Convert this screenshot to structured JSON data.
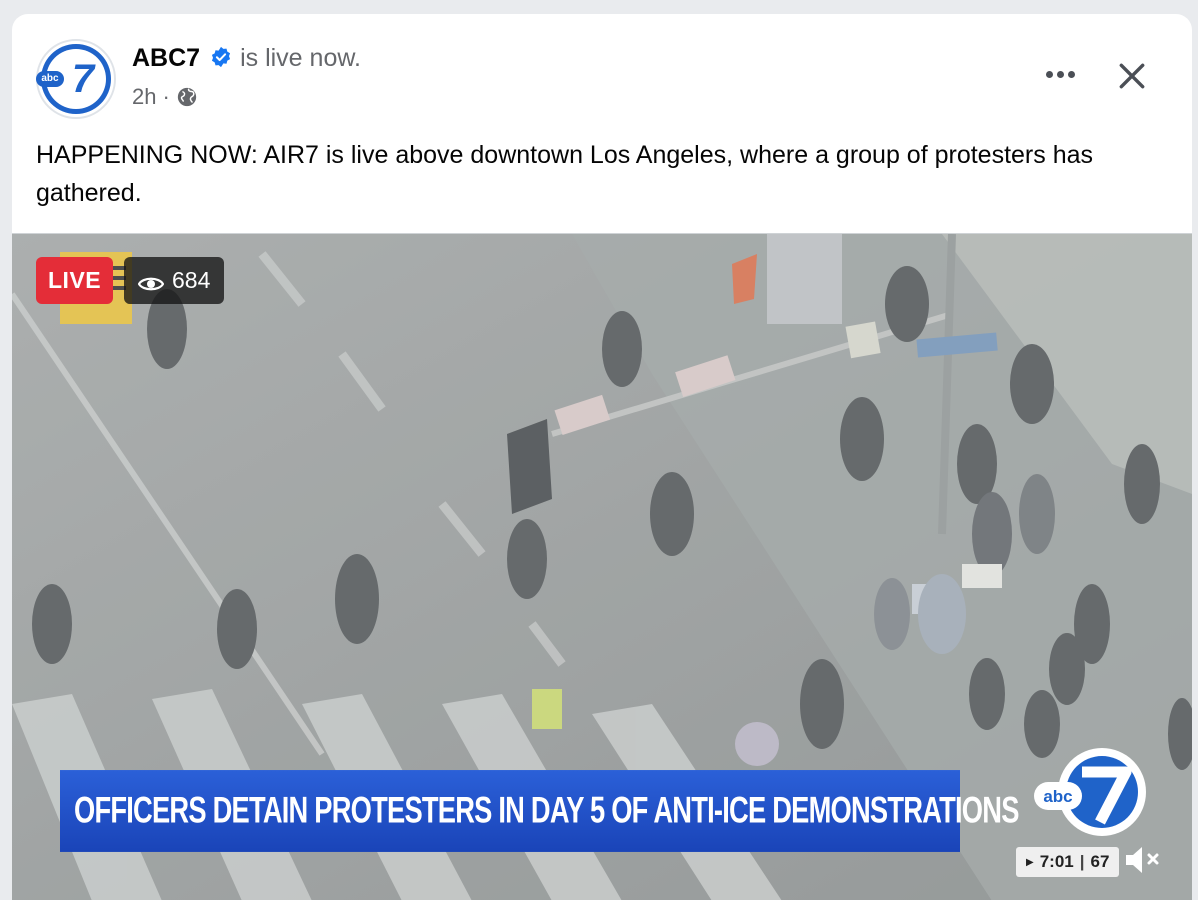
{
  "post": {
    "page_name": "ABC7",
    "status": "is live now.",
    "time": "2h",
    "separator": "·",
    "caption": "HAPPENING NOW: AIR7 is live above downtown Los Angeles, where a group of protesters has gathered."
  },
  "avatar": {
    "abc_label": "abc",
    "seven_label": "7"
  },
  "video": {
    "live_label": "LIVE",
    "viewer_count": "684",
    "lower_third": "OFFICERS DETAIN PROTESTERS IN DAY 5 OF ANTI-ICE DEMONSTRATIONS",
    "bug_abc": "abc",
    "bug_seven": "7",
    "elapsed": "7:01",
    "time_sep": "|",
    "temperature": "67"
  },
  "icons": {
    "verified": "verified-badge-icon",
    "globe": "globe-icon",
    "more": "more-options-icon",
    "close": "close-icon",
    "eye": "eye-icon",
    "mute": "muted-speaker-icon"
  },
  "colors": {
    "live": "#e42d38",
    "brand_blue": "#1f63c9",
    "lower_third": "#2b60d8"
  }
}
